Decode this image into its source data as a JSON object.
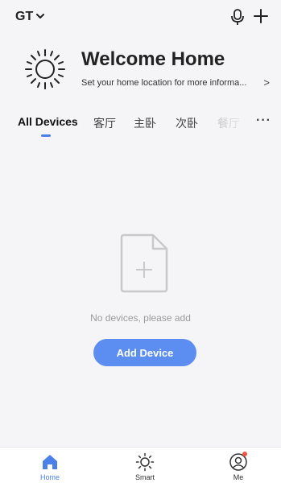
{
  "topbar": {
    "home_name": "GT",
    "home_chevron": "chevron-down-icon",
    "mic_icon": "microphone-icon",
    "add_icon": "plus-icon"
  },
  "welcome": {
    "icon": "sun-icon",
    "title": "Welcome Home",
    "subtitle": "Set your home location for more informa...",
    "arrow": ">"
  },
  "tabs": {
    "items": [
      {
        "label": "All Devices",
        "active": true
      },
      {
        "label": "客厅"
      },
      {
        "label": "主卧"
      },
      {
        "label": "次卧"
      },
      {
        "label": "餐厅"
      }
    ],
    "more": "···"
  },
  "empty_state": {
    "icon": "file-add-icon",
    "message": "No devices, please add",
    "button_label": "Add Device"
  },
  "bottom_nav": {
    "items": [
      {
        "label": "Home",
        "icon": "home-icon",
        "active": true
      },
      {
        "label": "Smart",
        "icon": "sun-icon"
      },
      {
        "label": "Me",
        "icon": "user-icon",
        "badge": true
      }
    ]
  },
  "colors": {
    "accent": "#4a80e8",
    "button": "#5b8ef0",
    "background": "#f5f5f7",
    "badge": "#f05545"
  }
}
